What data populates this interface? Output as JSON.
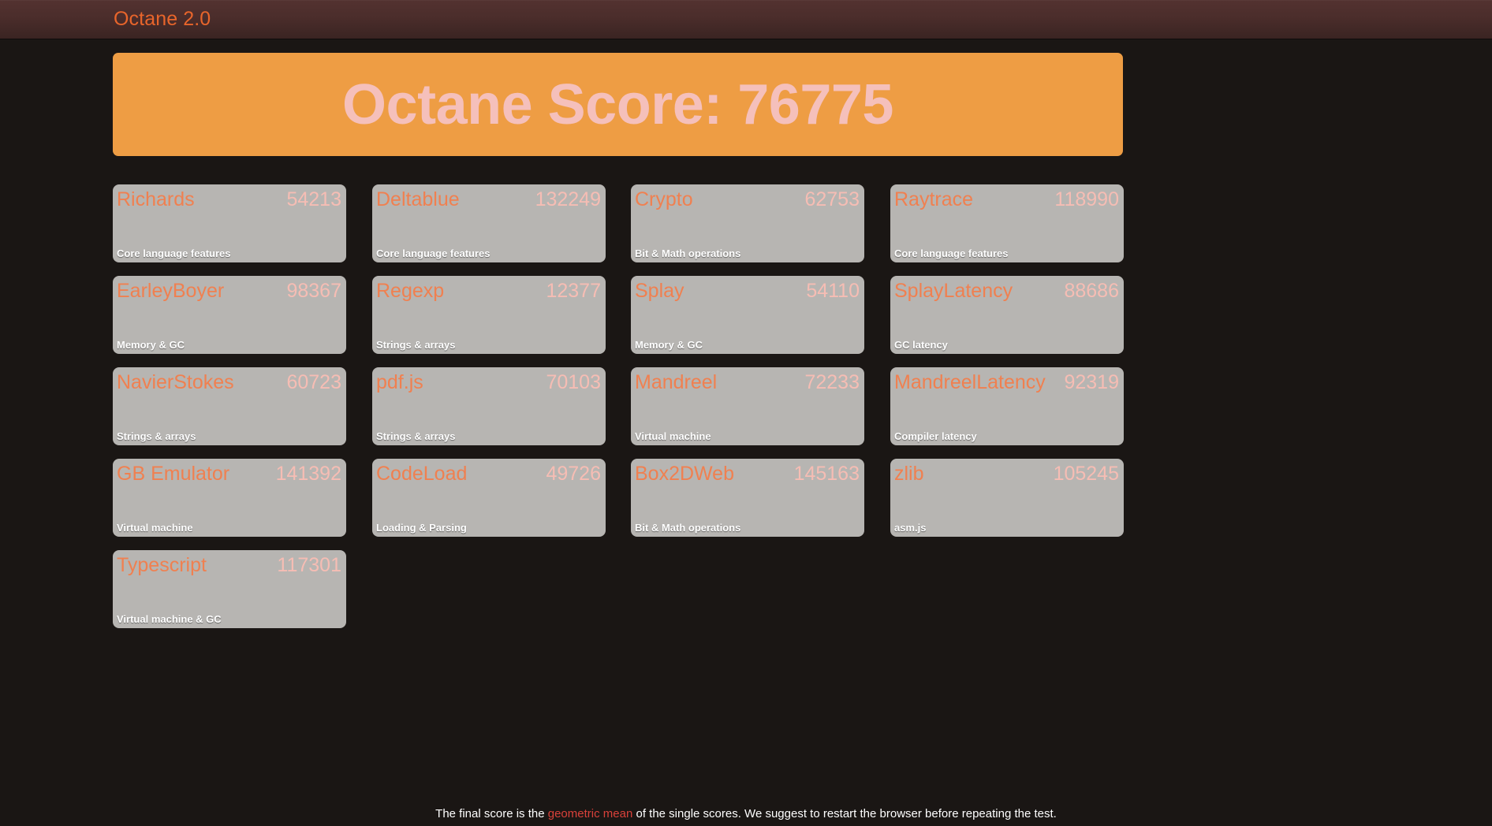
{
  "navbar": {
    "brand": "Octane 2.0"
  },
  "score_banner": {
    "label": "Octane Score",
    "value": "76775",
    "text": "Octane Score: 76775",
    "background_color": "#ee9d44",
    "text_color": "#f5c0bb"
  },
  "results": {
    "columns": 4,
    "cards": [
      {
        "name": "Richards",
        "score": "54213",
        "description": "Core language features"
      },
      {
        "name": "Deltablue",
        "score": "132249",
        "description": "Core language features"
      },
      {
        "name": "Crypto",
        "score": "62753",
        "description": "Bit & Math operations"
      },
      {
        "name": "Raytrace",
        "score": "118990",
        "description": "Core language features"
      },
      {
        "name": "EarleyBoyer",
        "score": "98367",
        "description": "Memory & GC"
      },
      {
        "name": "Regexp",
        "score": "12377",
        "description": "Strings & arrays"
      },
      {
        "name": "Splay",
        "score": "54110",
        "description": "Memory & GC"
      },
      {
        "name": "SplayLatency",
        "score": "88686",
        "description": "GC latency"
      },
      {
        "name": "NavierStokes",
        "score": "60723",
        "description": "Strings & arrays"
      },
      {
        "name": "pdf.js",
        "score": "70103",
        "description": "Strings & arrays"
      },
      {
        "name": "Mandreel",
        "score": "72233",
        "description": "Virtual machine"
      },
      {
        "name": "MandreelLatency",
        "score": "92319",
        "description": "Compiler latency"
      },
      {
        "name": "GB Emulator",
        "score": "141392",
        "description": "Virtual machine"
      },
      {
        "name": "CodeLoad",
        "score": "49726",
        "description": "Loading & Parsing"
      },
      {
        "name": "Box2DWeb",
        "score": "145163",
        "description": "Bit & Math operations"
      },
      {
        "name": "zlib",
        "score": "105245",
        "description": "asm.js"
      },
      {
        "name": "Typescript",
        "score": "117301",
        "description": "Virtual machine & GC"
      }
    ]
  },
  "footer": {
    "text_before": "The final score is the ",
    "link_text": "geometric mean",
    "text_after": " of the single scores. We suggest to restart the browser before repeating the test.",
    "link_color": "#d9413a"
  },
  "colors": {
    "page_background": "#1a1614",
    "navbar_gradient_top": "#533230",
    "navbar_gradient_bottom": "#3a2422",
    "brand_text": "#e8652b",
    "card_background": "#b7b5b2",
    "card_name": "#f08050",
    "card_score": "#f6bdb4",
    "card_description": "#ffffff"
  }
}
